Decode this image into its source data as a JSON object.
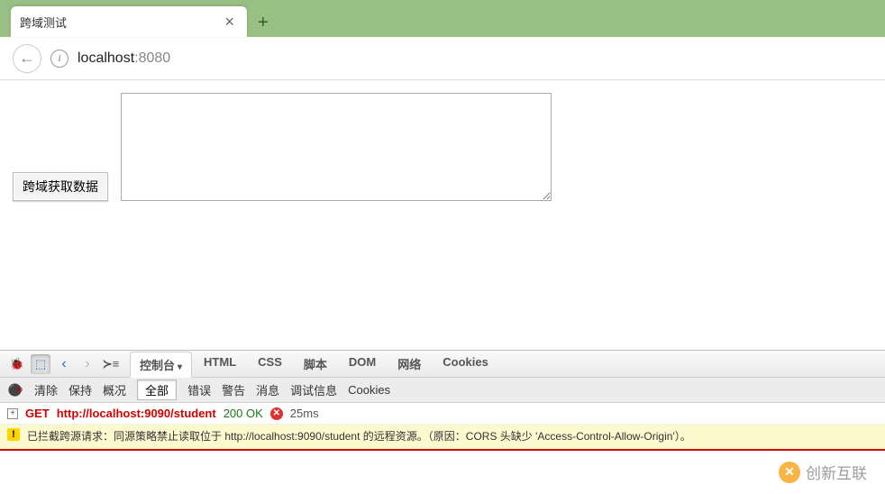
{
  "browser": {
    "tab_title": "跨域测试",
    "url_host": "localhost",
    "url_port": ":8080"
  },
  "page": {
    "button_label": "跨域获取数据",
    "textarea_value": ""
  },
  "devtools": {
    "tabs": [
      "控制台",
      "HTML",
      "CSS",
      "脚本",
      "DOM",
      "网络",
      "Cookies"
    ],
    "active_tab_index": 0,
    "sub": {
      "clear": "清除",
      "persist": "保持",
      "profile": "概况",
      "filter_all": "全部",
      "errors": "错误",
      "warnings": "警告",
      "info": "消息",
      "debug": "调试信息",
      "cookies": "Cookies"
    },
    "request": {
      "method": "GET",
      "url": "http://localhost:9090/student",
      "status": "200 OK",
      "time": "25ms"
    },
    "warning": "已拦截跨源请求：同源策略禁止读取位于 http://localhost:9090/student 的远程资源。（原因：CORS 头缺少 'Access-Control-Allow-Origin'）。"
  },
  "brand": {
    "text": "创新互联"
  }
}
